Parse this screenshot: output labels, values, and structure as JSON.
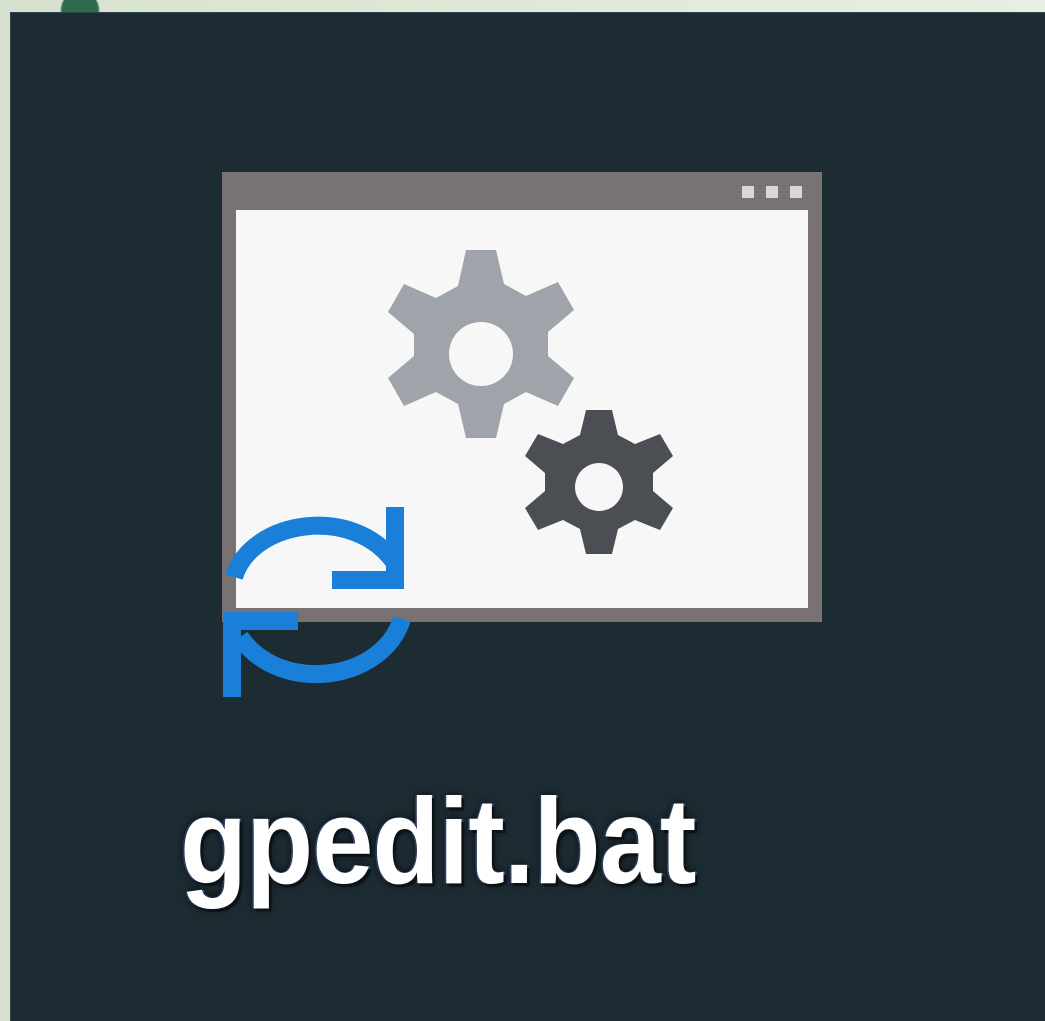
{
  "desktop_icon": {
    "filename": "gpedit.bat",
    "icon": "batch-file-icon",
    "badge_icon": "refresh-arrows-icon",
    "gear_icon": "gear-icon"
  },
  "colors": {
    "selection_background": "#1d2c33",
    "window_frame": "#787372",
    "window_body": "#f7f7f8",
    "gear_light": "#9fa3aa",
    "gear_dark": "#4b4f54",
    "arrow_blue": "#1a7fd8",
    "label_text": "#ffffff"
  }
}
